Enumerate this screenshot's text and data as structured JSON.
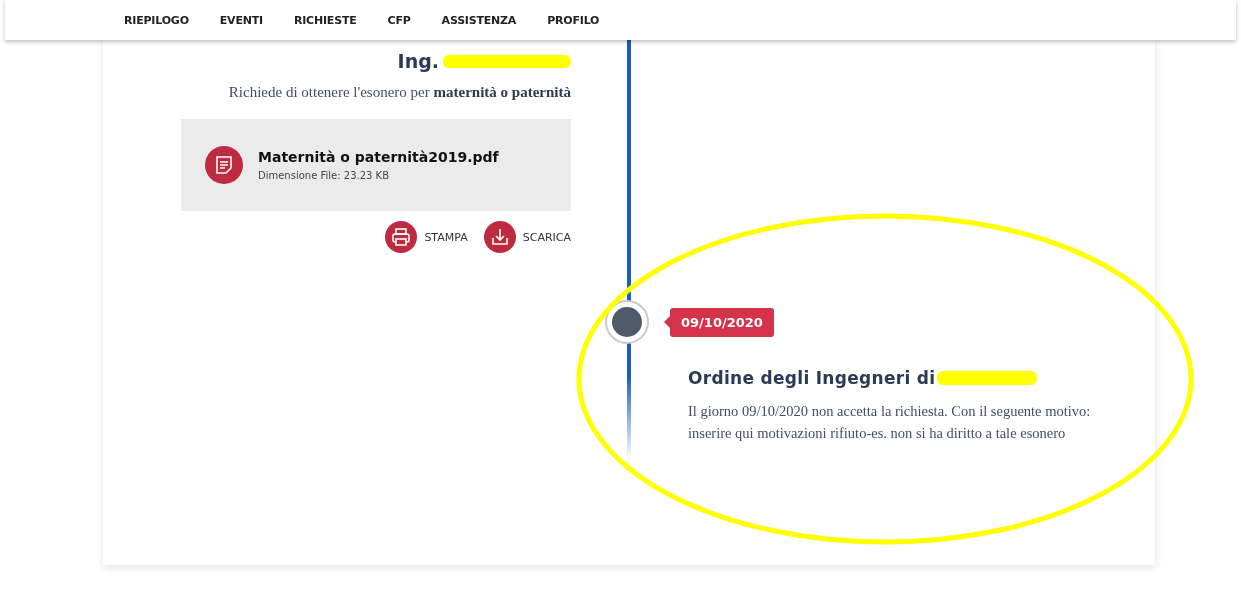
{
  "nav": {
    "items": [
      {
        "label": "RIEPILOGO"
      },
      {
        "label": "EVENTI"
      },
      {
        "label": "RICHIESTE"
      },
      {
        "label": "CFP"
      },
      {
        "label": "ASSISTENZA"
      },
      {
        "label": "PROFILO"
      }
    ]
  },
  "request": {
    "title": "Ing.",
    "description": "Richiede di ottenere l'esonero per **maternità o paternità**",
    "file": {
      "name": "Maternità o paternità2019.pdf",
      "size": "Dimensione File: 23.23 KB"
    },
    "actions": [
      {
        "kind": "print",
        "label": "STAMPA"
      },
      {
        "kind": "download",
        "label": "SCARICA"
      }
    ]
  },
  "event": {
    "date": "09/10/2020",
    "title": "Ordine degli Ingegneri di",
    "text": "Il giorno 09/10/2020 non accetta la richiesta. Con il seguente motivo: inserire qui motivazioni rifiuto-es. non si ha diritto a tale esonero"
  }
}
